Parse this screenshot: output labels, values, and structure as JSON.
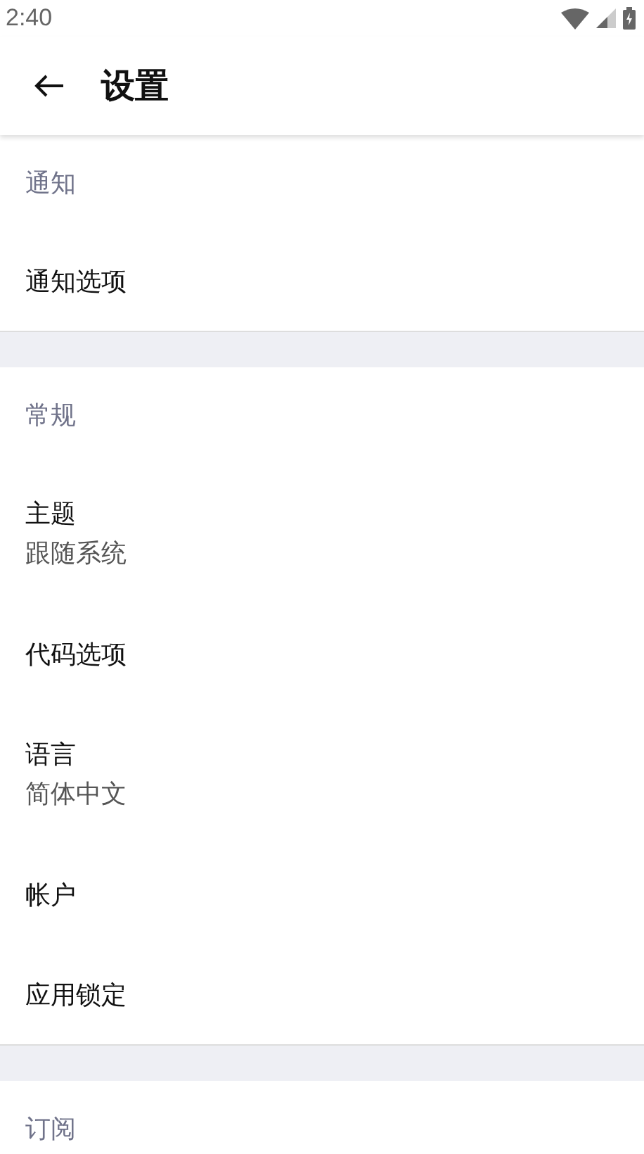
{
  "status_bar": {
    "time": "2:40"
  },
  "app_bar": {
    "title": "设置"
  },
  "sections": [
    {
      "header": "通知",
      "items": [
        {
          "title": "通知选项"
        }
      ]
    },
    {
      "header": "常规",
      "items": [
        {
          "title": "主题",
          "subtitle": "跟随系统"
        },
        {
          "title": "代码选项"
        },
        {
          "title": "语言",
          "subtitle": "简体中文"
        },
        {
          "title": "帐户"
        },
        {
          "title": "应用锁定"
        }
      ]
    },
    {
      "header": "订阅"
    }
  ]
}
